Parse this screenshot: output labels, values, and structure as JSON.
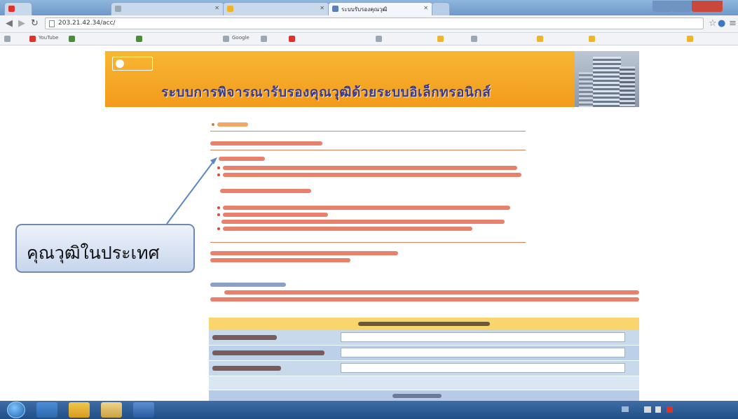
{
  "browser": {
    "tabs": [
      {
        "label": "",
        "favicon_color": "#e0312b",
        "active": false
      },
      {
        "label": "",
        "favicon_color": "#9aa7b5",
        "active": false
      },
      {
        "label": "",
        "favicon_color": "#f0b429",
        "active": false
      },
      {
        "label": "ระบบรับรองคุณวุฒิ",
        "favicon_color": "#5b7fb8",
        "active": true
      }
    ],
    "address": "203.21.42.34/acc/",
    "bookmarks": [
      {
        "label": "",
        "icon_color": "#9aa7b5"
      },
      {
        "label": "YouTube",
        "icon_color": "#e0312b"
      },
      {
        "label": "",
        "icon_color": "#4a8c3c"
      },
      {
        "label": "",
        "icon_color": "#4a8c3c"
      },
      {
        "label": "Google",
        "icon_color": "#9aa7b5"
      },
      {
        "label": "",
        "icon_color": "#9aa7b5"
      },
      {
        "label": "",
        "icon_color": "#e0312b"
      },
      {
        "label": "",
        "icon_color": "#9aa7b5"
      },
      {
        "label": "",
        "icon_color": "#f0b429"
      },
      {
        "label": "",
        "icon_color": "#9aa7b5"
      },
      {
        "label": "",
        "icon_color": "#f0b429"
      },
      {
        "label": "",
        "icon_color": "#f0b429"
      },
      {
        "label": "",
        "icon_color": "#f0b429"
      }
    ]
  },
  "page": {
    "logo_text": "",
    "banner_title": "ระบบการพิจารณารับรองคุณวุฒิด้วยระบบอิเล็กทรอนิกส์",
    "date_text": "",
    "login_text": ""
  },
  "callout": {
    "text": "คุณวุฒิในประเทศ"
  },
  "colors": {
    "banner": "#f5a623",
    "banner_title": "#3d3a8c",
    "menu_links": "#d94a3a",
    "form_header": "#f8d66d",
    "form_row": "#c9d9ec"
  },
  "taskbar": {
    "clock_time": "",
    "clock_date": ""
  }
}
